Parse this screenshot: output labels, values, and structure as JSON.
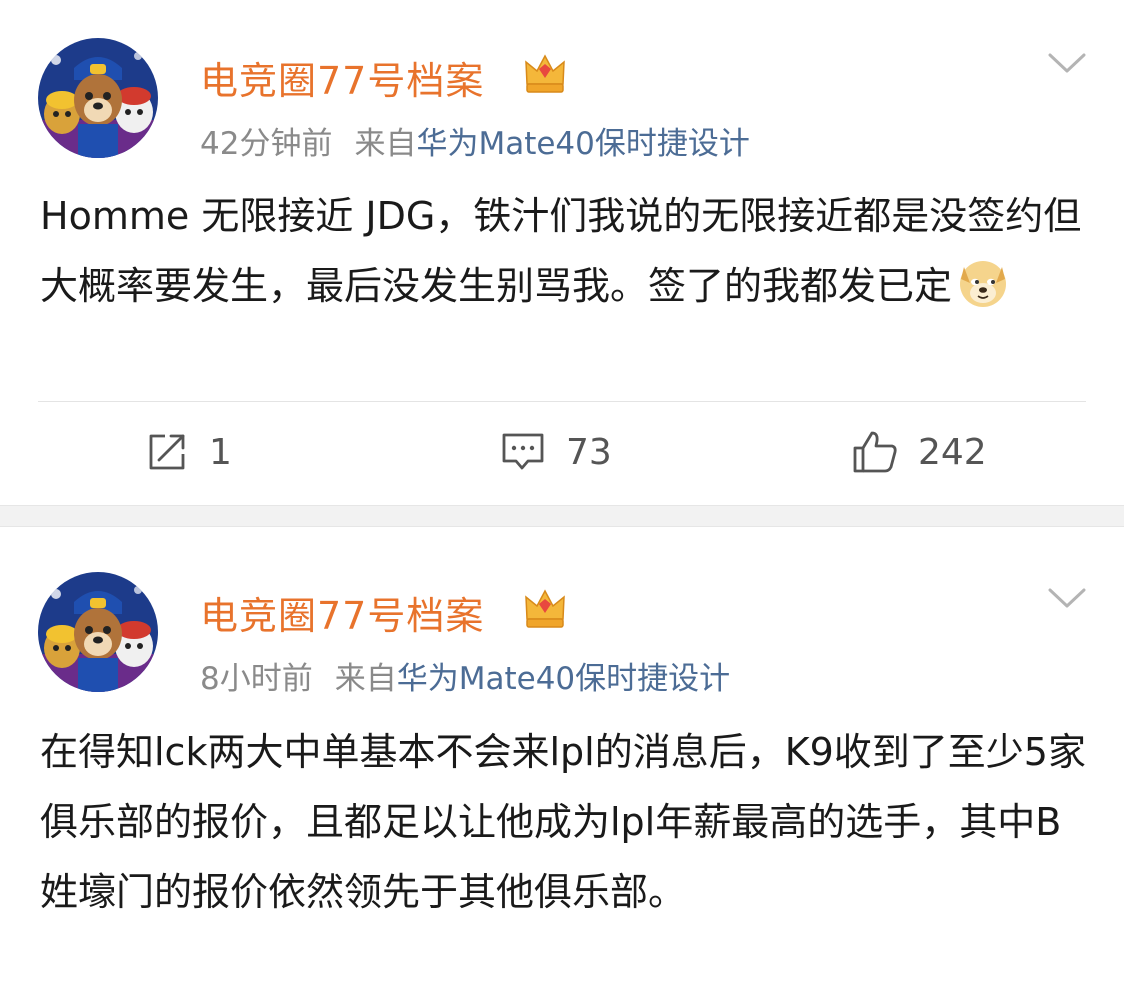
{
  "colors": {
    "username": "#e8732c",
    "device_link": "#4c6c95",
    "meta_text": "#8a8a8a",
    "body_text": "#1a1a1a",
    "action_text": "#555555",
    "separator": "#f2f2f2"
  },
  "icons": {
    "avatar": "paw-patrol-avatar",
    "vip_badge": "crown-vip-icon",
    "menu": "chevron-down-icon",
    "emoji": "doge-emoji",
    "repost": "repost-icon",
    "comment": "comment-icon",
    "like": "like-icon"
  },
  "posts": [
    {
      "username": "电竞圈77号档案",
      "time": "42分钟前",
      "source_prefix": "来自",
      "source_device": "华为Mate40保时捷设计",
      "text": "Homme 无限接近 JDG，铁汁们我说的无限接近都是没签约但大概率要发生，最后没发生别骂我。签了的我都发已定",
      "repost_count": "1",
      "comment_count": "73",
      "like_count": "242"
    },
    {
      "username": "电竞圈77号档案",
      "time": "8小时前",
      "source_prefix": "来自",
      "source_device": "华为Mate40保时捷设计",
      "text": "在得知lck两大中单基本不会来lpl的消息后，K9收到了至少5家俱乐部的报价，且都足以让他成为lpl年薪最高的选手，其中B姓壕门的报价依然领先于其他俱乐部。"
    }
  ]
}
